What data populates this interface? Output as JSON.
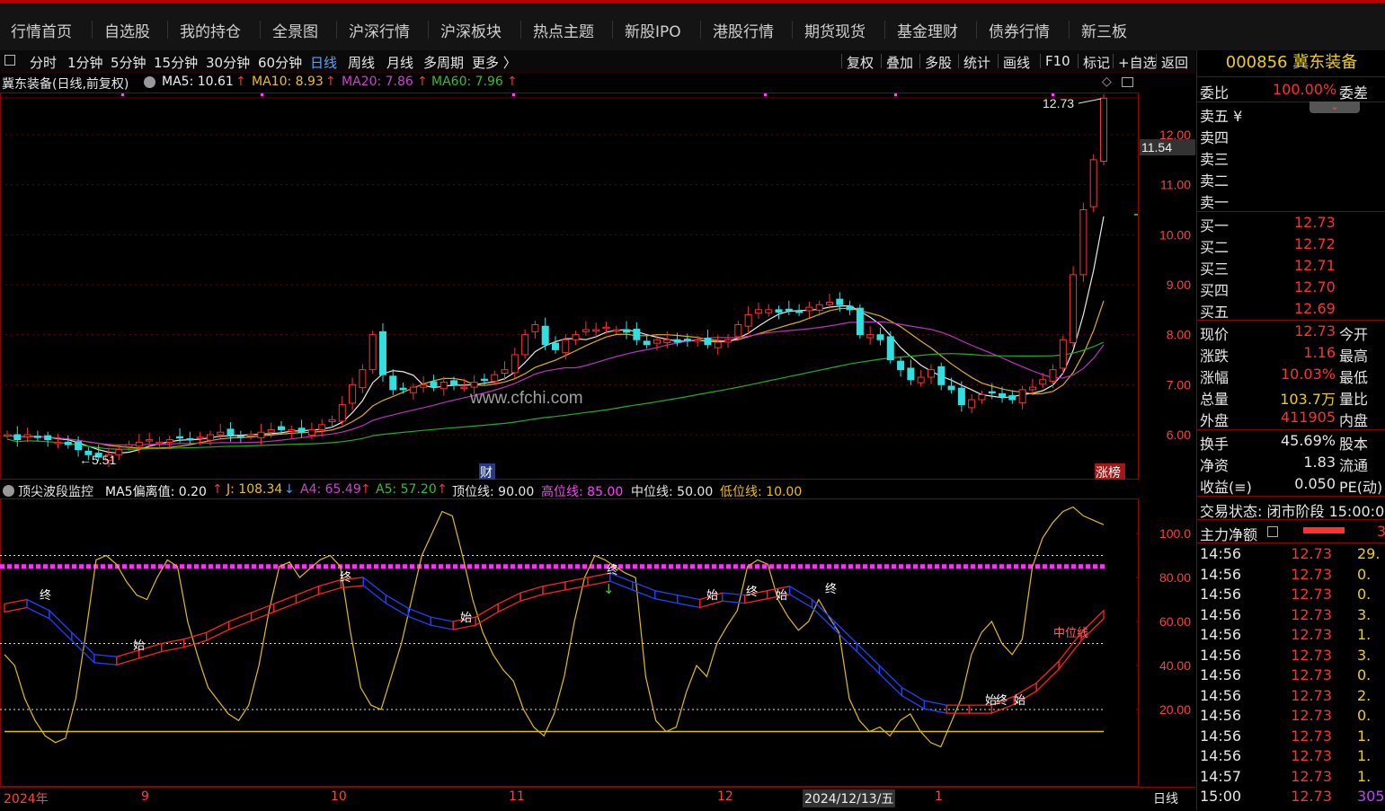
{
  "nav": {
    "items": [
      "行情首页",
      "自选股",
      "我的持仓",
      "全景图",
      "沪深行情",
      "沪深板块",
      "热点主题",
      "新股IPO",
      "港股行情",
      "期货现货",
      "基金理财",
      "债券行情",
      "新三板"
    ]
  },
  "periods": {
    "items": [
      "分时",
      "1分钟",
      "5分钟",
      "15分钟",
      "30分钟",
      "60分钟",
      "日线",
      "周线",
      "月线",
      "多周期",
      "更多 〉"
    ],
    "active": "日线"
  },
  "tools": {
    "items": [
      "复权",
      "叠加",
      "多股",
      "统计",
      "画线",
      "F10",
      "标记",
      "+自选",
      "返回"
    ]
  },
  "ma": {
    "title": "冀东装备(日线,前复权)",
    "ma5": "MA5: 10.61",
    "ma10": "MA10: 8.93",
    "ma20": "MA20: 7.86",
    "ma60": "MA60: 7.96",
    "arrow": "↑"
  },
  "main_chart": {
    "y_ticks": [
      "12.00",
      "11.00",
      "10.00",
      "9.00",
      "8.00",
      "7.00",
      "6.00"
    ],
    "price_label": "11.54",
    "high_label": "12.73",
    "low_label": "5.51",
    "watermark": "www.cfchi.com",
    "marker_cai": "财",
    "marker_zhangbang": "涨榜"
  },
  "indicator": {
    "name": "顶尖波段监控",
    "ma5dev": "MA5偏离值: 0.20",
    "j": "J: 108.34",
    "a4": "A4: 65.49",
    "a5": "A5: 57.20",
    "top": "顶位线: 90.00",
    "high": "高位线: 85.00",
    "mid": "中位线: 50.00",
    "low": "低位线: 10.00",
    "y_ticks": [
      "100.0",
      "80.00",
      "60.00",
      "40.00",
      "20.00"
    ],
    "mid_label": "中位线",
    "labels_start": "始",
    "labels_end": "终"
  },
  "xaxis": {
    "labels": [
      "2024年",
      "9",
      "10",
      "11",
      "12",
      "2024/12/13/五",
      "1"
    ],
    "period": "日线"
  },
  "quote": {
    "code_name": "000856 冀东装备",
    "weibi_label": "委比",
    "weibi_value": "100.00%",
    "weicha_label": "委差",
    "sell": [
      "卖五 ¥",
      "卖四",
      "卖三",
      "卖二",
      "卖一"
    ],
    "buy_labels": [
      "买一",
      "买二",
      "买三",
      "买四",
      "买五"
    ],
    "buy_prices": [
      "12.73",
      "12.72",
      "12.71",
      "12.70",
      "12.69"
    ],
    "stats": [
      {
        "label": "现价",
        "value": "12.73",
        "label2": "今开"
      },
      {
        "label": "涨跌",
        "value": "1.16",
        "label2": "最高"
      },
      {
        "label": "涨幅",
        "value": "10.03%",
        "label2": "最低"
      },
      {
        "label": "总量",
        "value": "103.7万",
        "label2": "量比"
      },
      {
        "label": "外盘",
        "value": "411905",
        "label2": "内盘"
      }
    ],
    "stats2": [
      {
        "label": "换手",
        "value": "45.69%",
        "label2": "股本"
      },
      {
        "label": "净资",
        "value": "1.83",
        "label2": "流通"
      },
      {
        "label": "收益(≡)",
        "value": "0.050",
        "label2": "PE(动)"
      }
    ],
    "trade_status": "交易状态: 闭市阶段 15:00:0",
    "main_net_label": "主力净额",
    "main_net_value": "3",
    "ticks": [
      {
        "time": "14:56",
        "price": "12.73",
        "vol": "29."
      },
      {
        "time": "14:56",
        "price": "12.73",
        "vol": "0."
      },
      {
        "time": "14:56",
        "price": "12.73",
        "vol": "0."
      },
      {
        "time": "14:56",
        "price": "12.73",
        "vol": "3."
      },
      {
        "time": "14:56",
        "price": "12.73",
        "vol": "1."
      },
      {
        "time": "14:56",
        "price": "12.73",
        "vol": "3."
      },
      {
        "time": "14:56",
        "price": "12.73",
        "vol": "0."
      },
      {
        "time": "14:56",
        "price": "12.73",
        "vol": "2."
      },
      {
        "time": "14:56",
        "price": "12.73",
        "vol": "0."
      },
      {
        "time": "14:56",
        "price": "12.73",
        "vol": "1."
      },
      {
        "time": "14:56",
        "price": "12.73",
        "vol": "1."
      },
      {
        "time": "14:57",
        "price": "12.73",
        "vol": "1."
      },
      {
        "time": "15:00",
        "price": "12.73",
        "vol": "305"
      }
    ]
  },
  "chart_data": {
    "type": "candlestick",
    "title": "冀东装备(日线,前复权)",
    "ylim": [
      5.3,
      13.0
    ],
    "closes": [
      6.0,
      5.9,
      6.0,
      5.95,
      5.9,
      5.85,
      5.8,
      5.7,
      5.6,
      5.55,
      5.6,
      5.7,
      5.8,
      5.85,
      5.9,
      5.85,
      5.9,
      5.95,
      5.9,
      5.95,
      6.0,
      6.05,
      6.0,
      5.95,
      6.0,
      6.05,
      6.1,
      6.1,
      6.1,
      6.05,
      6.1,
      6.2,
      6.3,
      6.6,
      7.0,
      7.3,
      8.0,
      7.2,
      6.9,
      6.9,
      6.95,
      7.0,
      6.95,
      7.05,
      7.0,
      6.95,
      7.05,
      7.1,
      7.2,
      7.3,
      7.6,
      8.0,
      8.2,
      7.8,
      7.7,
      7.9,
      8.0,
      8.1,
      8.1,
      8.15,
      8.1,
      8.05,
      7.9,
      7.8,
      7.9,
      7.9,
      7.85,
      7.9,
      7.9,
      7.8,
      7.85,
      7.9,
      8.2,
      8.4,
      8.5,
      8.5,
      8.45,
      8.5,
      8.45,
      8.55,
      8.6,
      8.65,
      8.6,
      8.5,
      8.0,
      8.0,
      7.9,
      7.5,
      7.3,
      7.1,
      7.15,
      7.3,
      7.0,
      6.9,
      6.6,
      6.7,
      6.8,
      6.85,
      6.75,
      6.7,
      6.9,
      6.95,
      7.1,
      7.3,
      7.9,
      9.2,
      10.5,
      11.5,
      12.73
    ],
    "ma_latest": {
      "MA5": 10.61,
      "MA10": 8.93,
      "MA20": 7.86,
      "MA60": 7.96
    },
    "indicator_series": {
      "J": [
        45,
        40,
        25,
        15,
        8,
        5,
        7,
        25,
        55,
        88,
        90,
        86,
        78,
        72,
        70,
        80,
        88,
        85,
        60,
        44,
        30,
        24,
        18,
        15,
        22,
        40,
        65,
        85,
        87,
        80,
        84,
        88,
        90,
        85,
        55,
        30,
        22,
        20,
        35,
        50,
        70,
        90,
        100,
        110,
        108,
        90,
        70,
        55,
        45,
        38,
        33,
        20,
        12,
        8,
        18,
        35,
        60,
        80,
        90,
        88,
        85,
        82,
        80,
        35,
        15,
        10,
        12,
        28,
        40,
        35,
        50,
        58,
        65,
        85,
        88,
        86,
        70,
        62,
        56,
        60,
        70,
        62,
        55,
        25,
        15,
        10,
        12,
        8,
        15,
        18,
        10,
        5,
        3,
        14,
        25,
        45,
        55,
        60,
        50,
        45,
        52,
        85,
        98,
        105,
        110,
        112,
        108,
        106,
        104
      ]
    }
  }
}
